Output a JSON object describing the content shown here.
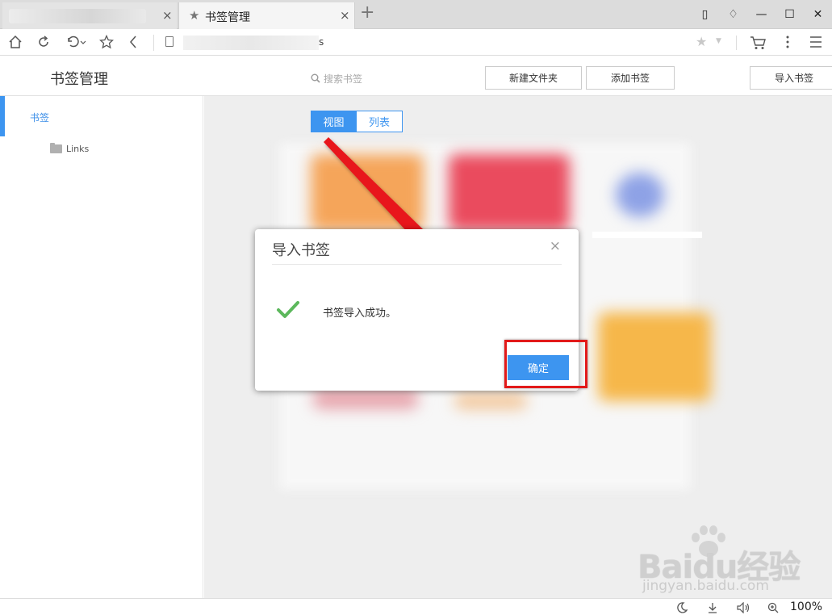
{
  "browser": {
    "tabs": [
      {
        "title": "",
        "close": "×"
      },
      {
        "title": "书签管理",
        "close": "×"
      }
    ],
    "new_tab": "+",
    "window_controls": {
      "restore_tab": "▯",
      "skin": "♢",
      "minimize": "—",
      "maximize": "☐",
      "close": "✕"
    },
    "address": {
      "tail": "s"
    },
    "zoom": "100%"
  },
  "page": {
    "title": "书签管理",
    "search_placeholder": "搜索书签",
    "buttons": {
      "new_folder": "新建文件夹",
      "add_bookmark": "添加书签",
      "import": "导入书签"
    }
  },
  "sidebar": {
    "active": "书签",
    "folders": [
      {
        "name": "Links"
      }
    ]
  },
  "view_tabs": {
    "grid": "视图",
    "list": "列表"
  },
  "dialog": {
    "title": "导入书签",
    "message": "书签导入成功。",
    "ok": "确定",
    "close": "×"
  },
  "watermark": {
    "logo": "Baidu经验",
    "url": "jingyan.baidu.com"
  },
  "colors": {
    "accent": "#3d95f0",
    "highlight": "#e21a1a",
    "arrow": "#e8141c",
    "success": "#5cb85c"
  }
}
